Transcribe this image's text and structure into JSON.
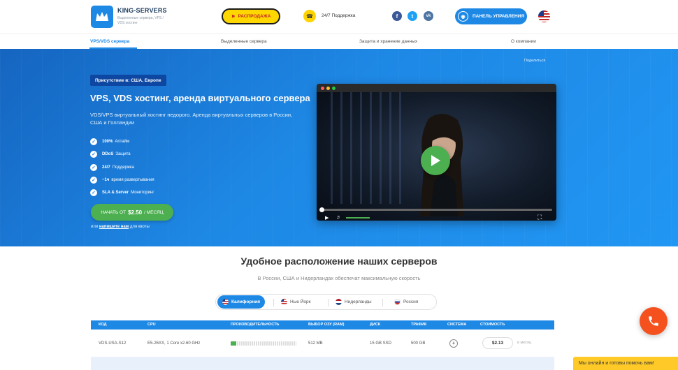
{
  "brand": {
    "name": "KING-SERVERS",
    "tagline": "Выделенные сервера, VPS / VDS хостинг",
    "accent": "#1e88e5"
  },
  "header": {
    "sale_label": "РАСПРОДАЖА",
    "support_label": "24/7 Поддержка",
    "social": [
      "f",
      "t",
      "vk"
    ],
    "panel_label": "ПАНЕЛЬ УПРАВЛЕНИЯ",
    "language_icon": "us-flag-icon"
  },
  "nav": {
    "items": [
      "VPS/VDS сервера",
      "Выделенные сервера",
      "Защита и хранение данных",
      "О компании"
    ]
  },
  "hero": {
    "share_label": "Поделиться",
    "presence_badge": "Присутствие в: США, Европе",
    "title": "VPS, VDS хостинг, аренда виртуального сервера",
    "description": "VDS/VPS виртуальный хостинг недорого. Аренда виртуальных серверов в России, США и Голландии",
    "features": [
      {
        "bold": "100%",
        "text": "Аптайм"
      },
      {
        "bold": "DDoS",
        "text": "Защита"
      },
      {
        "bold": "24/7",
        "text": "Поддержка"
      },
      {
        "bold": "~1ч",
        "text": "время развертывания"
      },
      {
        "bold": "SLA & Server",
        "text": "Мониторинг"
      }
    ],
    "cta_prefix": "НАЧАТЬ ОТ",
    "cta_price": "$2.50",
    "cta_suffix": "/ МЕСЯЦ",
    "note_prefix": "или",
    "note_link": "напишите нам",
    "note_suffix": "для квоты"
  },
  "video": {
    "progress": 0
  },
  "locations": {
    "title": "Удобное расположение наших серверов",
    "subtitle": "В России, США и Нидерландах обеспечат максимальную скорость",
    "tabs": [
      "Калифорния",
      "Нью Йорк",
      "Нидерланды",
      "Россия"
    ],
    "active_tab": 0
  },
  "table": {
    "headers": [
      "КОД",
      "CPU",
      "ПРОИЗВОДИТЕЛЬНОСТЬ",
      "ВЫБОР ОЗУ (RAM)",
      "ДИСК",
      "ТРАФИК",
      "СИСТЕМА",
      "СТОИМОСТЬ"
    ],
    "rows": [
      {
        "code": "VDS-USA-S12",
        "cpu": "E5-26XX, 1 Core x2.60 GHz",
        "performance": 0.08,
        "ram": "512 MB",
        "disk": "15 GB SSD",
        "traffic": "500 GB",
        "os_icon": "linux-icon",
        "price": "$2.13",
        "period": "в месяц"
      }
    ]
  },
  "floating": {
    "chat_text": "Мы онлайн и готовы помочь вам!",
    "phone_color": "#f4511e"
  }
}
